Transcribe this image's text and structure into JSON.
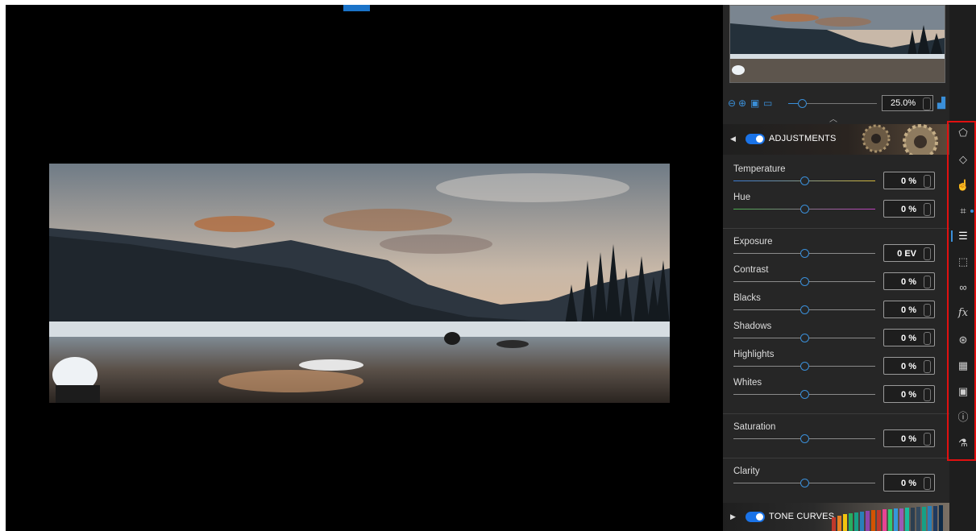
{
  "navigator": {
    "zoom_value": "25.0%"
  },
  "adjustments": {
    "title": "ADJUSTMENTS",
    "enabled": true,
    "sliders": [
      {
        "label": "Temperature",
        "value": "0 %"
      },
      {
        "label": "Hue",
        "value": "0 %"
      },
      {
        "label": "Exposure",
        "value": "0 EV"
      },
      {
        "label": "Contrast",
        "value": "0 %"
      },
      {
        "label": "Blacks",
        "value": "0 %"
      },
      {
        "label": "Shadows",
        "value": "0 %"
      },
      {
        "label": "Highlights",
        "value": "0 %"
      },
      {
        "label": "Whites",
        "value": "0 %"
      },
      {
        "label": "Saturation",
        "value": "0 %"
      },
      {
        "label": "Clarity",
        "value": "0 %"
      }
    ]
  },
  "tone_curves": {
    "title": "TONE CURVES",
    "enabled": true
  },
  "tools": [
    "selection-tool-icon",
    "eraser-icon",
    "hand-icon",
    "crop-icon",
    "adjustments-icon",
    "marquee-icon",
    "red-eye-icon",
    "fx-icon",
    "color-mixer-icon",
    "texture-icon",
    "frame-icon",
    "info-icon",
    "lab-icon"
  ],
  "colors": {
    "accent": "#1a73e8",
    "highlight_border": "#e01010"
  }
}
